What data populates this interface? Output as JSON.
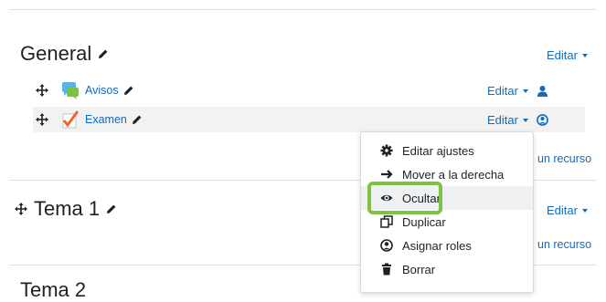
{
  "sections": [
    {
      "title": "General",
      "edit_label": "Editar"
    },
    {
      "title": "Tema 1",
      "edit_label": "Editar"
    },
    {
      "title": "Tema 2"
    }
  ],
  "activities": [
    {
      "name": "Avisos",
      "icon": "forum-icon",
      "edit_label": "Editar",
      "status_icon": "user-icon"
    },
    {
      "name": "Examen",
      "icon": "quiz-icon",
      "edit_label": "Editar",
      "status_icon": "user-circle-icon"
    }
  ],
  "add_resource_label": "un recurso",
  "action_menu": {
    "items": [
      {
        "label": "Editar ajustes",
        "icon": "gear-icon"
      },
      {
        "label": "Mover a la derecha",
        "icon": "arrow-right-icon"
      },
      {
        "label": "Ocultar",
        "icon": "eye-icon",
        "highlighted": true
      },
      {
        "label": "Duplicar",
        "icon": "copy-icon"
      },
      {
        "label": "Asignar roles",
        "icon": "user-circle-icon"
      },
      {
        "label": "Borrar",
        "icon": "trash-icon"
      }
    ]
  },
  "colors": {
    "link": "#0f6cbf",
    "highlight": "#7fc241"
  }
}
